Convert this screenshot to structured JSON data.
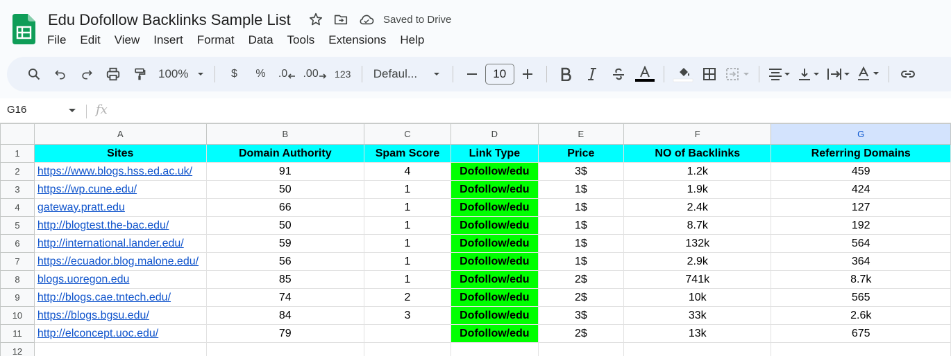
{
  "app": {
    "title": "Edu Dofollow Backlinks Sample List",
    "saved_status": "Saved to Drive",
    "brand_color": "#0f9d58"
  },
  "menu": [
    "File",
    "Edit",
    "View",
    "Insert",
    "Format",
    "Data",
    "Tools",
    "Extensions",
    "Help"
  ],
  "toolbar": {
    "zoom": "100%",
    "currency": "$",
    "percent": "%",
    "decrease_decimal": ".0",
    "increase_decimal": ".00",
    "number_format": "123",
    "font": "Defaul...",
    "font_size": "10",
    "icons": [
      "search-icon",
      "undo-icon",
      "redo-icon",
      "print-icon",
      "paint-format-icon",
      "bold-icon",
      "italic-icon",
      "strikethrough-icon",
      "text-color-icon",
      "fill-color-icon",
      "borders-icon",
      "merge-icon",
      "align-icon",
      "valign-icon",
      "text-direction-icon",
      "text-rotation-icon",
      "link-icon"
    ]
  },
  "formula_bar": {
    "cell_ref": "G16",
    "fx": "fx"
  },
  "sheet": {
    "columns": [
      "A",
      "B",
      "C",
      "D",
      "E",
      "F",
      "G"
    ],
    "selected_column": "G",
    "row_numbers": [
      "1",
      "2",
      "3",
      "4",
      "5",
      "6",
      "7",
      "8",
      "9",
      "10",
      "11",
      "12"
    ],
    "header_row": [
      "Sites",
      "Domain Authority",
      "Spam Score",
      "Link Type",
      "Price",
      "NO of Backlinks",
      "Referring Domains"
    ],
    "header_color": "#00ffff",
    "link_type_color": "#00ff00",
    "rows": [
      [
        "https://www.blogs.hss.ed.ac.uk/",
        "91",
        "4",
        "Dofollow/edu",
        "3$",
        "1.2k",
        "459"
      ],
      [
        "https://wp.cune.edu/",
        "50",
        "1",
        "Dofollow/edu",
        "1$",
        "1.9k",
        "424"
      ],
      [
        "gateway.pratt.edu",
        "66",
        "1",
        "Dofollow/edu",
        "1$",
        "2.4k",
        "127"
      ],
      [
        "http://blogtest.the-bac.edu/",
        "50",
        "1",
        "Dofollow/edu",
        "1$",
        "8.7k",
        "192"
      ],
      [
        "http://international.lander.edu/",
        "59",
        "1",
        "Dofollow/edu",
        "1$",
        "132k",
        "564"
      ],
      [
        "https://ecuador.blog.malone.edu/",
        "56",
        "1",
        "Dofollow/edu",
        "1$",
        "2.9k",
        "364"
      ],
      [
        "blogs.uoregon.edu",
        "85",
        "1",
        "Dofollow/edu",
        "2$",
        "741k",
        "8.7k"
      ],
      [
        "http://blogs.cae.tntech.edu/",
        "74",
        "2",
        "Dofollow/edu",
        "2$",
        "10k",
        "565"
      ],
      [
        "https://blogs.bgsu.edu/",
        "84",
        "3",
        "Dofollow/edu",
        "3$",
        "33k",
        "2.6k"
      ],
      [
        "http://elconcept.uoc.edu/",
        "79",
        "",
        "Dofollow/edu",
        "2$",
        "13k",
        "675"
      ]
    ]
  }
}
